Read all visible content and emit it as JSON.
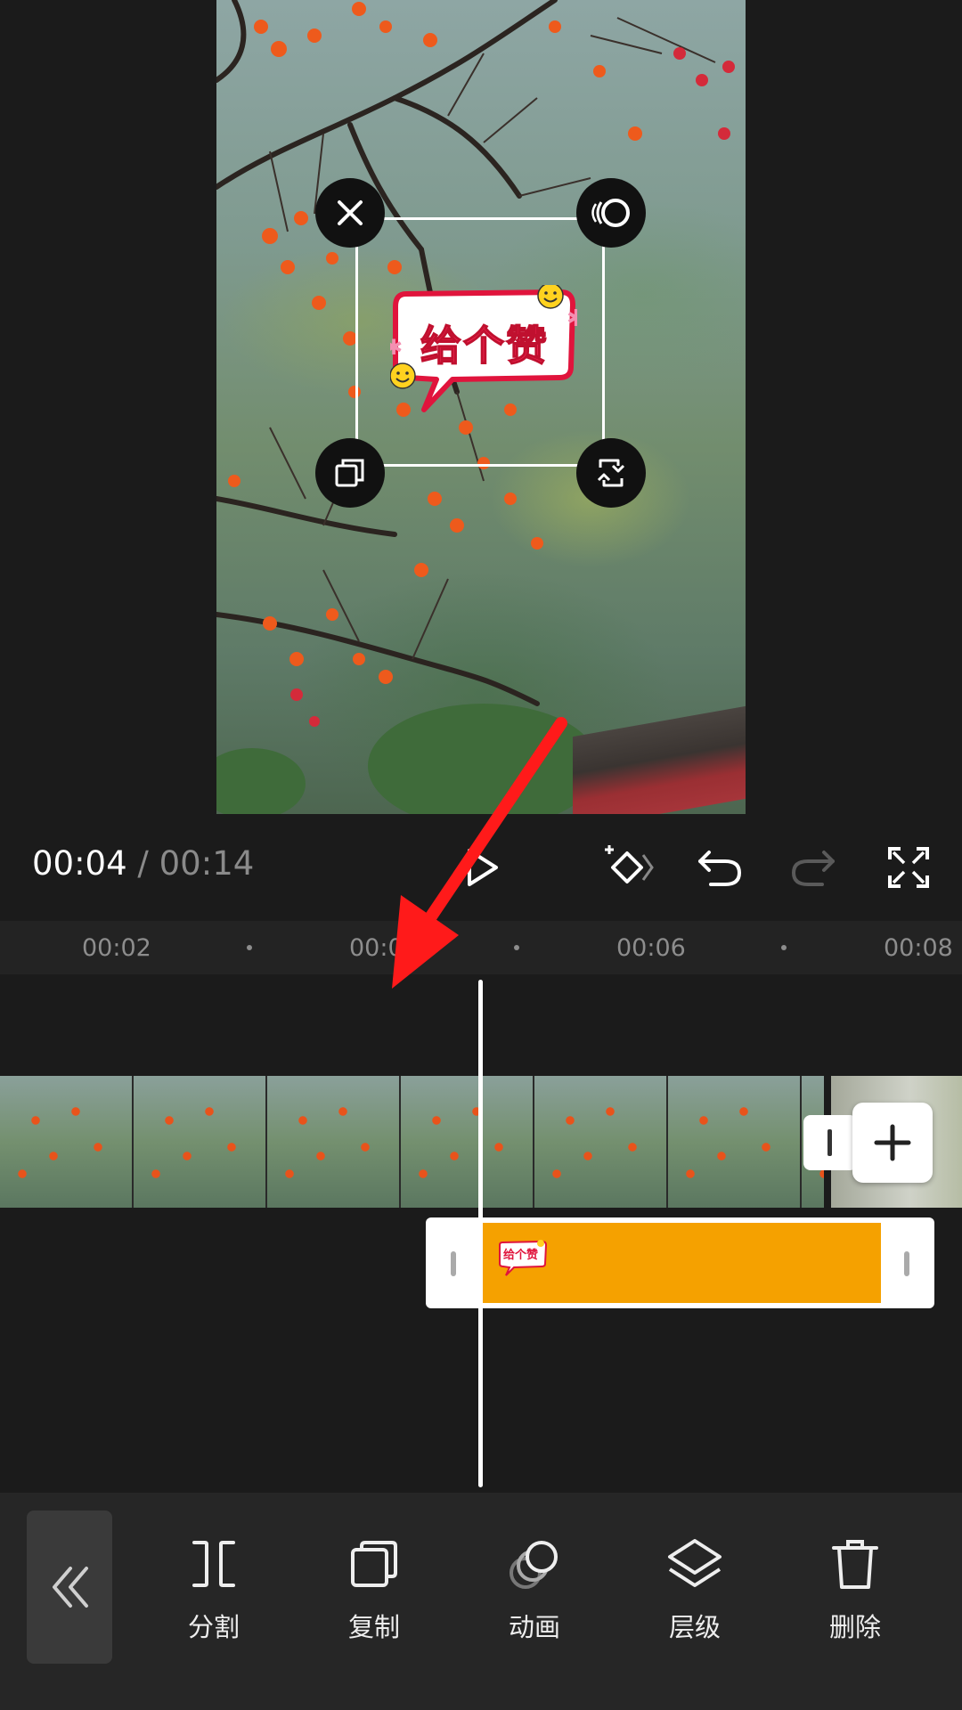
{
  "sticker": {
    "text": "给个赞"
  },
  "playback": {
    "current_time": "00:04",
    "separator": "/",
    "total_time": "00:14"
  },
  "ruler": {
    "ticks": [
      "00:02",
      "00:04",
      "00:06",
      "00:08"
    ]
  },
  "toolbar": {
    "items": [
      {
        "label": "分割",
        "icon": "split-icon"
      },
      {
        "label": "复制",
        "icon": "copy-icon"
      },
      {
        "label": "动画",
        "icon": "animation-icon"
      },
      {
        "label": "层级",
        "icon": "layers-icon"
      },
      {
        "label": "删除",
        "icon": "trash-icon"
      }
    ]
  },
  "colors": {
    "accent_track": "#f5a100",
    "annotation_arrow": "#ff1a1a",
    "background": "#1b1b1b"
  }
}
